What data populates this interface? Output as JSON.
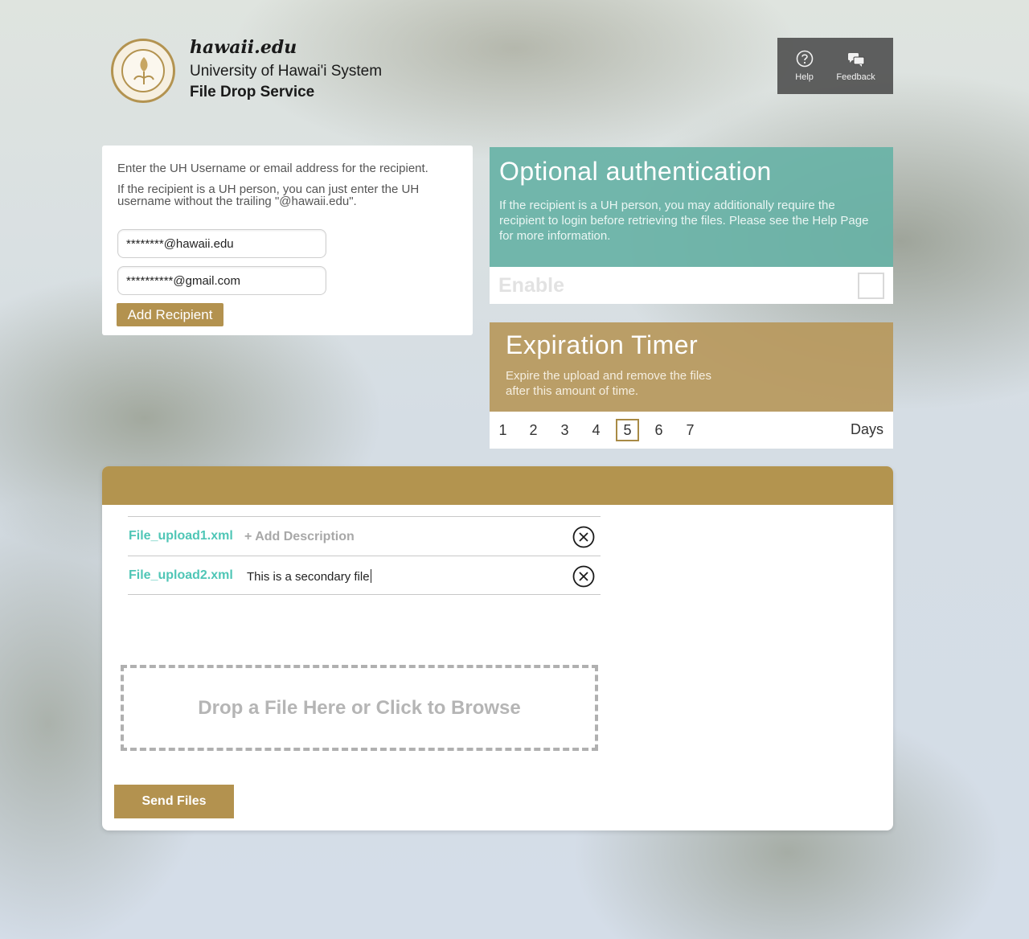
{
  "header": {
    "wordmark": "hawaii.edu",
    "system_name": "University of Hawai'i System",
    "service_name": "File Drop Service",
    "help_label": "Help",
    "feedback_label": "Feedback"
  },
  "recipient": {
    "instruction": "Enter the UH Username or email address for the recipient.",
    "hint": "If the recipient is a UH person, you can just enter the UH username without the trailing \"@hawaii.edu\".",
    "recipients": [
      "********@hawaii.edu",
      "**********@gmail.com"
    ],
    "add_button": "Add Recipient"
  },
  "auth": {
    "title": "Optional authentication",
    "description": "If the recipient is a UH person, you may additionally require the recipient to login before retrieving the files. Please see the Help Page for more information.",
    "enable_label": "Enable",
    "enabled": false
  },
  "expiration": {
    "title": "Expiration Timer",
    "description": "Expire the upload and remove the files after this amount of time.",
    "days": [
      "1",
      "2",
      "3",
      "4",
      "5",
      "6",
      "7"
    ],
    "selected_day": "5",
    "unit_label": "Days"
  },
  "files": {
    "items": [
      {
        "name": "File_upload1.xml",
        "description": "",
        "add_description_label": "+ Add Description"
      },
      {
        "name": "File_upload2.xml",
        "description": "This is a secondary file"
      }
    ],
    "dropzone_label": "Drop a File Here or Click to Browse",
    "send_button": "Send Files"
  },
  "colors": {
    "gold": "#b3924f",
    "teal": "#68b2a6",
    "file_name": "#4fc6b6"
  }
}
